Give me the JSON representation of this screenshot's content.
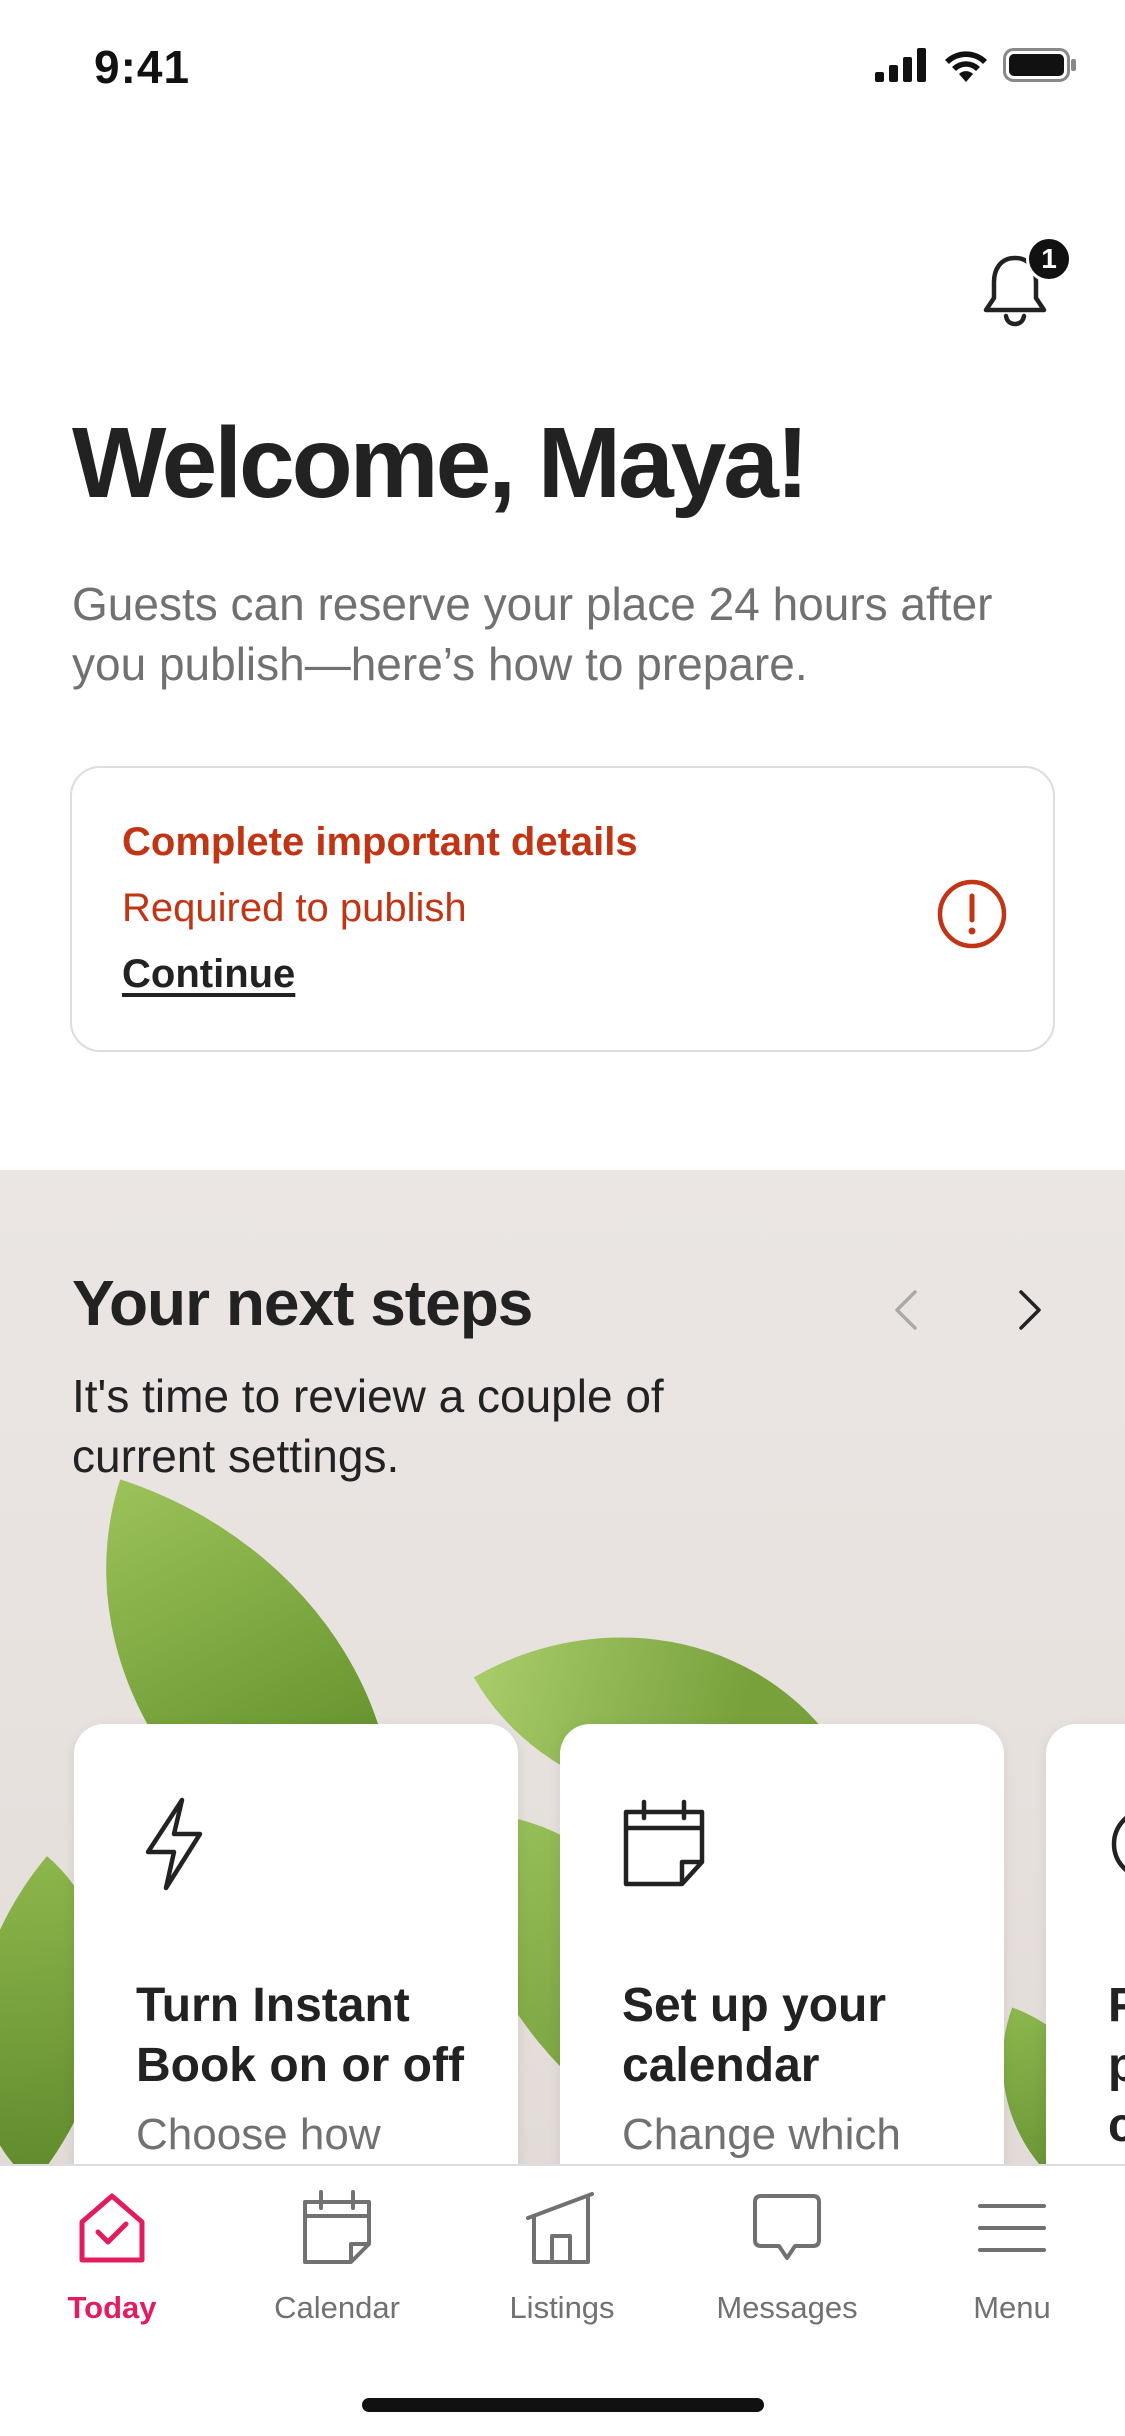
{
  "status_bar": {
    "time": "9:41"
  },
  "header": {
    "notification_count": "1"
  },
  "welcome": {
    "title": "Welcome, Maya!",
    "subtitle": "Guests can reserve your place 24 hours after you publish—here’s how to prepare."
  },
  "alert": {
    "title": "Complete important details",
    "subtitle": "Required to publish",
    "link": "Continue"
  },
  "next_steps": {
    "title": "Your next steps",
    "subtitle": "It's time to review a couple of current settings.",
    "cards": [
      {
        "icon": "lightning-icon",
        "title": "Turn Instant Book on or off",
        "desc": "Choose how"
      },
      {
        "icon": "calendar-icon",
        "title": "Set up your calendar",
        "desc": "Change which"
      },
      {
        "icon": "circle-icon",
        "title": "P p c",
        "desc": ""
      }
    ]
  },
  "tabs": [
    {
      "label": "Today",
      "icon": "home-check-icon",
      "active": true
    },
    {
      "label": "Calendar",
      "icon": "calendar-icon"
    },
    {
      "label": "Listings",
      "icon": "building-icon"
    },
    {
      "label": "Messages",
      "icon": "chat-bubble-icon"
    },
    {
      "label": "Menu",
      "icon": "hamburger-icon"
    }
  ],
  "colors": {
    "accent": "#E31C5F",
    "error": "#C13515",
    "text": "#222222",
    "muted": "#717171"
  }
}
